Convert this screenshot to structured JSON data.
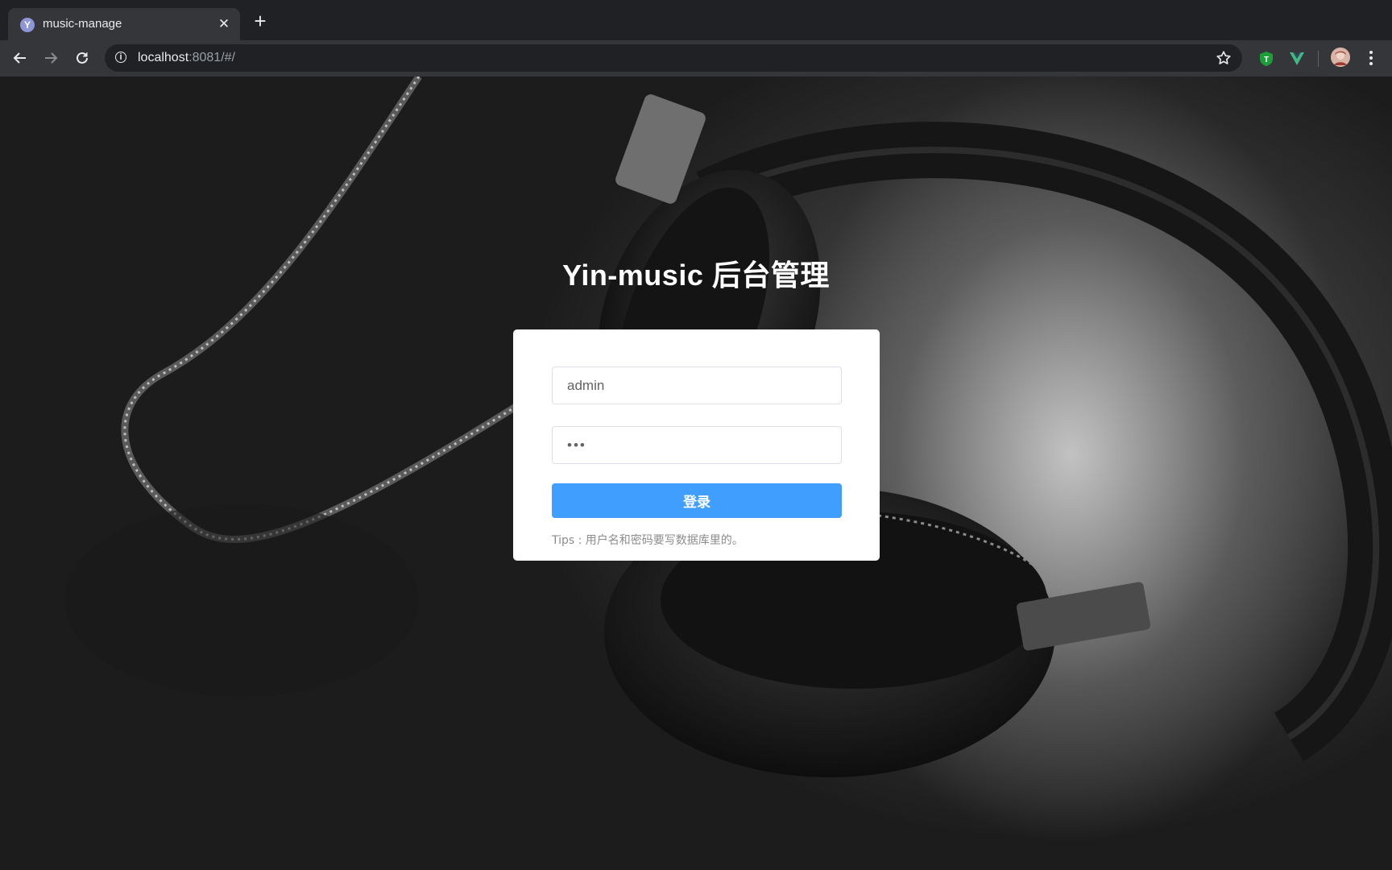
{
  "browser": {
    "tab": {
      "title": "music-manage",
      "favicon_letter": "Y"
    },
    "address": {
      "host": "localhost",
      "rest": ":8081/#/"
    }
  },
  "page": {
    "title": "Yin-music 后台管理",
    "username_value": "admin",
    "password_value": "•••",
    "login_label": "登录",
    "tips": "Tips : 用户名和密码要写数据库里的。"
  },
  "icons": {
    "back": "arrow-left-icon",
    "forward": "arrow-right-icon",
    "reload": "reload-icon",
    "info": "info-icon",
    "bookmark": "star-icon",
    "extension_1": "shield-t-icon",
    "extension_2": "vue-devtools-icon",
    "menu": "kebab-menu-icon"
  },
  "colors": {
    "primary_button": "#409eff",
    "frame": "#202124",
    "toolbar": "#35363a"
  }
}
